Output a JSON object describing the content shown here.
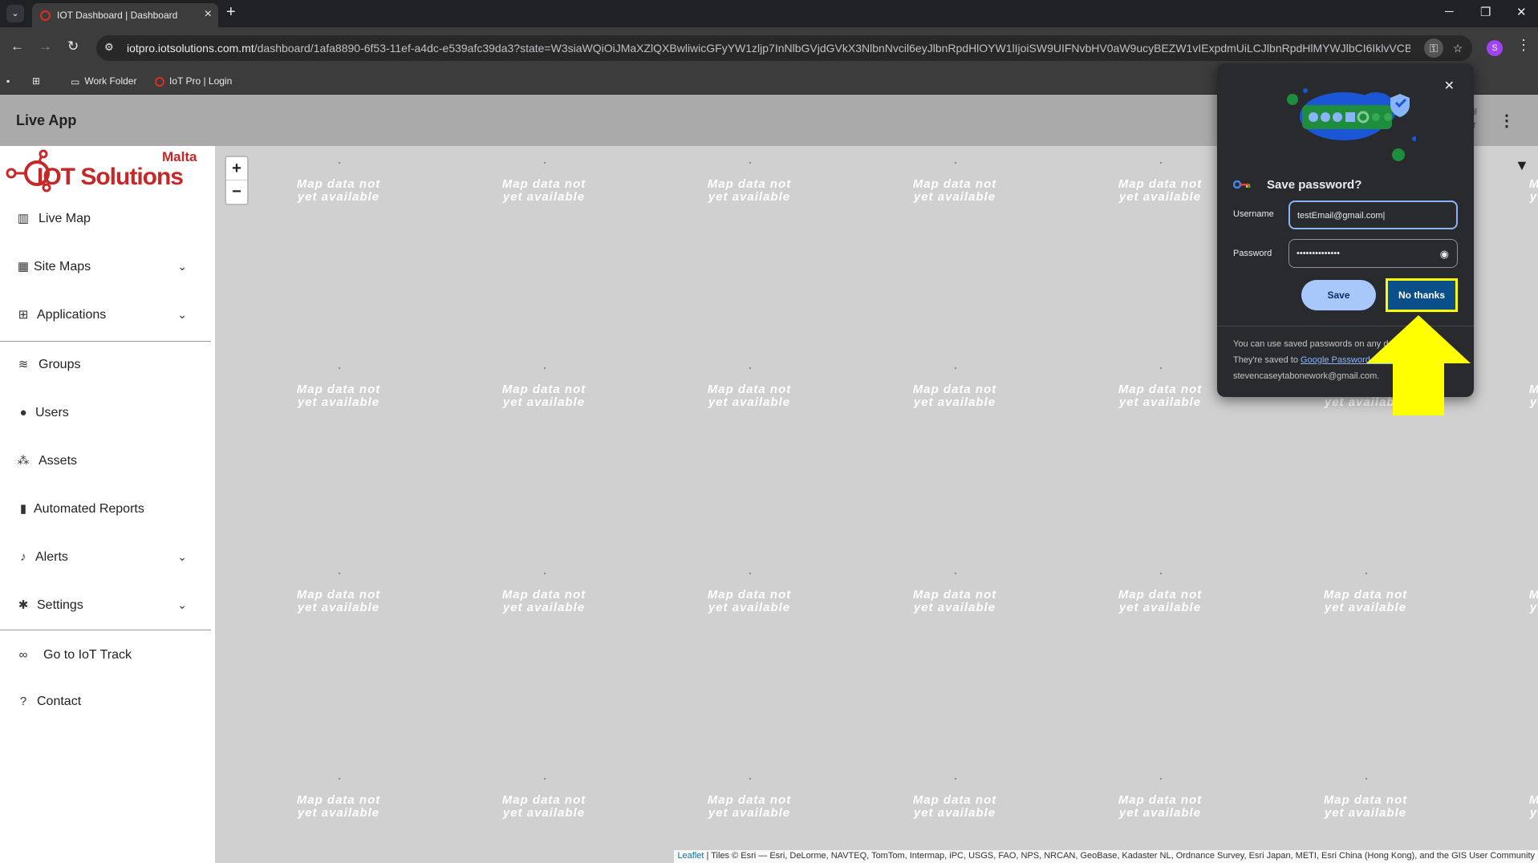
{
  "browser": {
    "tab_title": "IOT Dashboard | Dashboard",
    "url_host": "iotpro.iotsolutions.com.mt",
    "url_path": "/dashboard/1afa8890-6f53-11ef-a4dc-e539afc39da3?state=W3siaWQiOiJMaXZlQXBwliwicGFyYW1zljp7InNlbGVjdGVkX3NlbnNvcil6eyJlbnRpdHlOYW1lIjoiSW9UIFNvbHV0aW9ucyBEZW1vIExpdmUiLCJlbnRpdHlMYWJlbCI6IklvVCBTb2x...",
    "bookmarks": [
      "Work Folder",
      "IoT Pro | Login"
    ],
    "profile_initial": "S"
  },
  "app": {
    "title": "Live App",
    "header_right_line1": "ail",
    "header_right_line2": "er",
    "logo_text": "IOT Solutions",
    "logo_sub": "Malta"
  },
  "sidebar": {
    "items": [
      {
        "label": "Live Map",
        "icon": "map-icon"
      },
      {
        "label": "Site Maps",
        "icon": "building-icon",
        "expandable": true
      },
      {
        "label": "Applications",
        "icon": "grid-icon",
        "expandable": true
      },
      {
        "label": "Groups",
        "icon": "layers-icon"
      },
      {
        "label": "Users",
        "icon": "user-icon"
      },
      {
        "label": "Assets",
        "icon": "cubes-icon"
      },
      {
        "label": "Automated Reports",
        "icon": "file-icon"
      },
      {
        "label": "Alerts",
        "icon": "bell-icon",
        "expandable": true
      },
      {
        "label": "Settings",
        "icon": "gear-icon",
        "expandable": true
      },
      {
        "label": "Go to IoT Track",
        "icon": "link-icon"
      },
      {
        "label": "Contact",
        "icon": "question-icon"
      }
    ]
  },
  "map": {
    "tile_line1": "Map data not",
    "tile_line2": "yet available",
    "zoom_in": "+",
    "zoom_out": "−",
    "attribution_leaflet": "Leaflet",
    "attribution_text": " | Tiles © Esri — Esri, DeLorme, NAVTEQ, TomTom, Intermap, iPC, USGS, FAO, NPS, NRCAN, GeoBase, Kadaster NL, Ordnance Survey, Esri Japan, METI, Esri China (Hong Kong), and the GIS User Community"
  },
  "password_popup": {
    "title": "Save password?",
    "username_label": "Username",
    "username_value": "testEmail@gmail.com",
    "password_label": "Password",
    "password_value": "••••••••••••••",
    "save_label": "Save",
    "no_thanks_label": "No thanks",
    "footer_text": "You can use saved passwords on any device. They're saved to ",
    "footer_link": "Google Password Manager",
    "footer_account": "stevencaseytabonework@gmail.com."
  },
  "colors": {
    "highlight": "#ffff00",
    "accent": "#8ab4f8",
    "map_bg": "#d0d0d0"
  }
}
